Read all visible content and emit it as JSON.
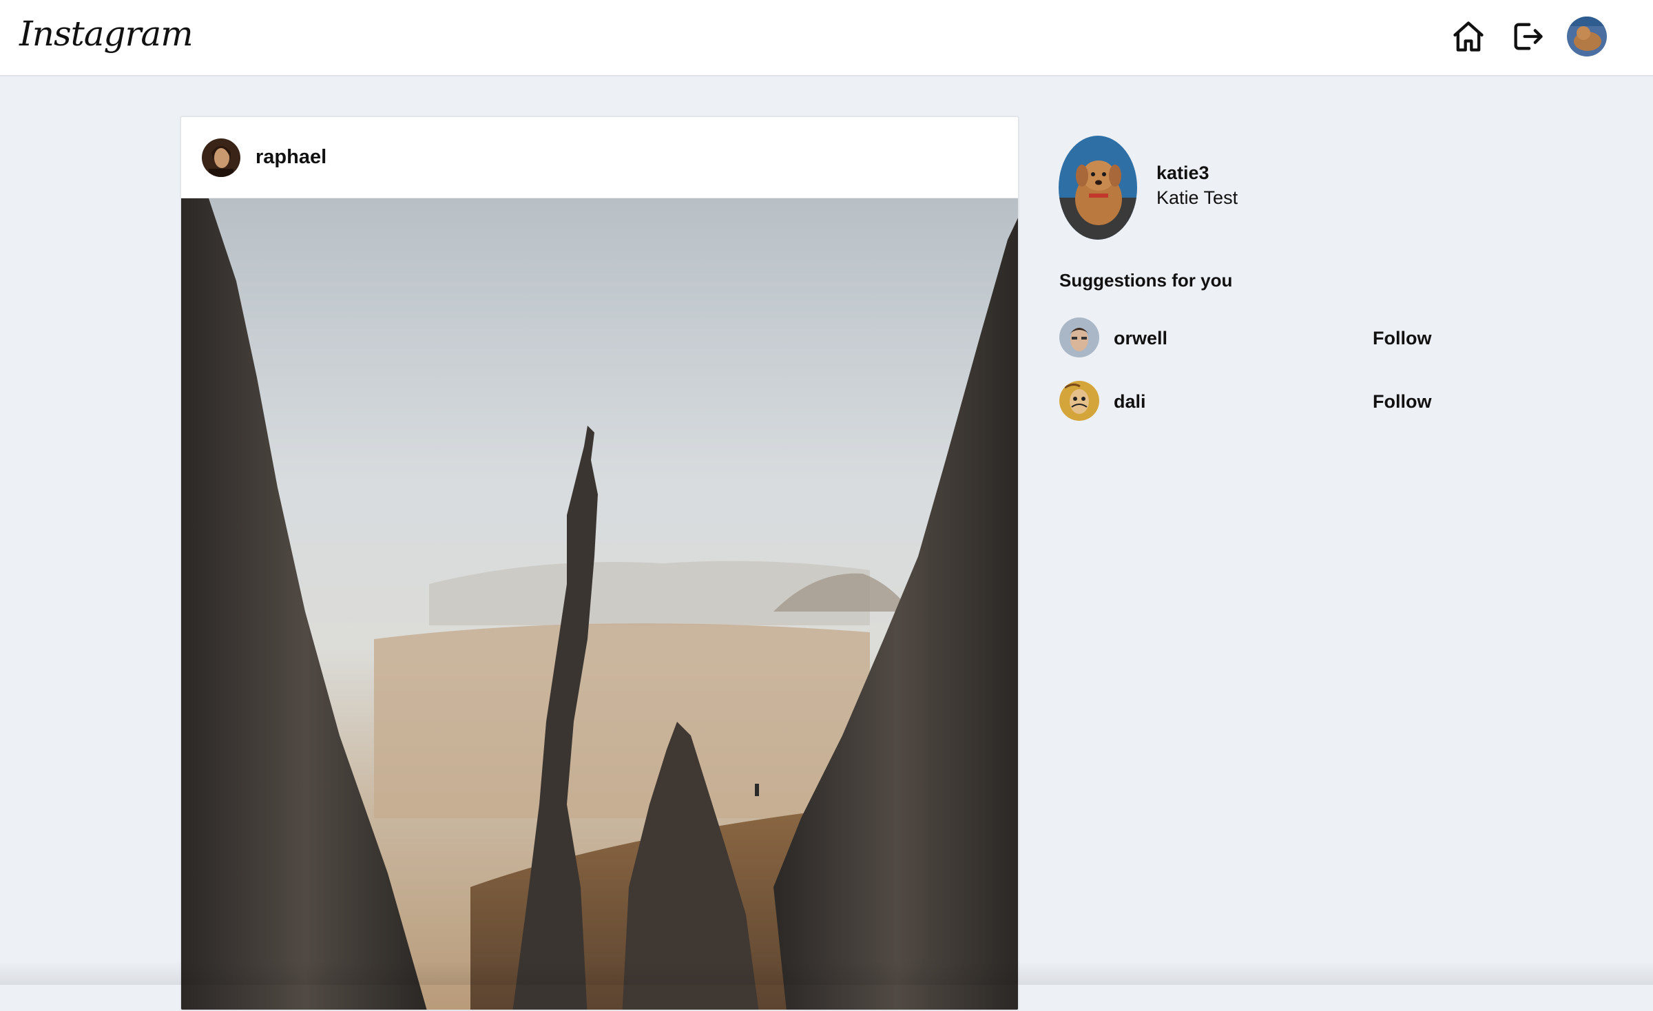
{
  "app": {
    "logo_text": "Instagram"
  },
  "nav": {
    "home_icon": "home-icon",
    "logout_icon": "logout-icon",
    "avatar": "user-avatar"
  },
  "post": {
    "username": "raphael",
    "image_description_icon": "photo"
  },
  "profile": {
    "username": "katie3",
    "full_name": "Katie Test"
  },
  "suggestions": {
    "title": "Suggestions for you",
    "items": [
      {
        "username": "orwell",
        "action": "Follow"
      },
      {
        "username": "dali",
        "action": "Follow"
      }
    ]
  },
  "colors": {
    "background": "#edf0f5",
    "header": "#ffffff",
    "text": "#111111"
  }
}
